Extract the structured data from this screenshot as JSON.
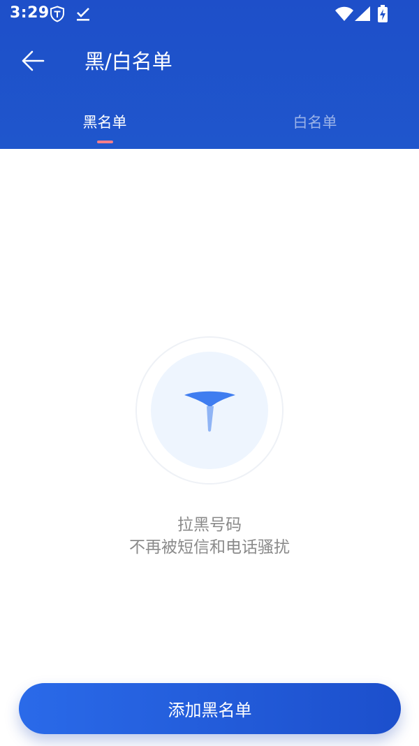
{
  "status_bar": {
    "time": "3:29",
    "icons": [
      "shield-icon",
      "checkmark-icon",
      "wifi-icon",
      "signal-icon",
      "battery-charging-icon"
    ]
  },
  "header": {
    "title": "黑/白名单",
    "back_icon": "arrow-left-icon"
  },
  "tabs": [
    {
      "label": "黑名单",
      "active": true
    },
    {
      "label": "白名单",
      "active": false
    }
  ],
  "empty_state": {
    "icon": "blacklist-pin-icon",
    "line1": "拉黑号码",
    "line2": "不再被短信和电话骚扰"
  },
  "add_button": {
    "label": "添加黑名单"
  },
  "colors": {
    "header_bg": "#1f52ca",
    "accent": "#2a6ae9",
    "indicator": "#f47e8a",
    "muted_text": "#8a8a8a"
  }
}
